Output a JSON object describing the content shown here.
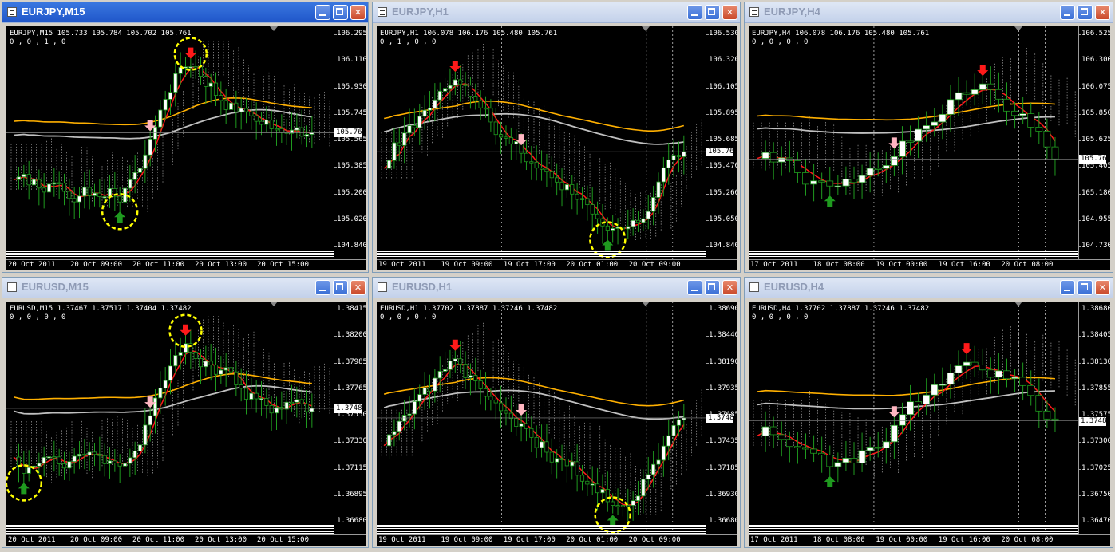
{
  "windows": [
    {
      "id": "eurjpy-m15",
      "title": "EURJPY,M15",
      "active": true,
      "info_line": "EURJPY,M15  105.733 105.784 105.702 105.761",
      "info_line2": "0 , 0 , 1 , 0",
      "current_price": "105.761",
      "price_levels": [
        "106.295",
        "106.110",
        "105.930",
        "105.745",
        "105.565",
        "105.385",
        "105.200",
        "105.020",
        "104.840"
      ],
      "time_labels": [
        "20 Oct 2011",
        "20 Oct 09:00",
        "20 Oct 11:00",
        "20 Oct 13:00",
        "20 Oct 15:00"
      ]
    },
    {
      "id": "eurjpy-h1",
      "title": "EURJPY,H1",
      "active": false,
      "info_line": "EURJPY,H1  106.078 106.176 105.480 105.761",
      "info_line2": "0 , 1 , 0 , 0",
      "current_price": "105.761",
      "price_levels": [
        "106.530",
        "106.320",
        "106.105",
        "105.895",
        "105.685",
        "105.470",
        "105.260",
        "105.050",
        "104.840"
      ],
      "time_labels": [
        "19 Oct 2011",
        "19 Oct 09:00",
        "19 Oct 17:00",
        "20 Oct 01:00",
        "20 Oct 09:00"
      ]
    },
    {
      "id": "eurjpy-h4",
      "title": "EURJPY,H4",
      "active": false,
      "info_line": "EURJPY,H4  106.078 106.176 105.480 105.761",
      "info_line2": "0 , 0 , 0 , 0",
      "current_price": "105.761",
      "price_levels": [
        "106.525",
        "106.300",
        "106.075",
        "105.850",
        "105.625",
        "105.405",
        "105.180",
        "104.955",
        "104.730"
      ],
      "time_labels": [
        "17 Oct 2011",
        "18 Oct 08:00",
        "19 Oct 00:00",
        "19 Oct 16:00",
        "20 Oct 08:00"
      ]
    },
    {
      "id": "eurusd-m15",
      "title": "EURUSD,M15",
      "active": false,
      "info_line": "EURUSD,M15  1.37467 1.37517 1.37404 1.37482",
      "info_line2": "0 , 0 , 0 , 0",
      "current_price": "1.37482",
      "price_levels": [
        "1.38415",
        "1.38200",
        "1.37985",
        "1.37765",
        "1.37550",
        "1.37330",
        "1.37115",
        "1.36895",
        "1.36680"
      ],
      "time_labels": [
        "20 Oct 2011",
        "20 Oct 09:00",
        "20 Oct 11:00",
        "20 Oct 13:00",
        "20 Oct 15:00"
      ]
    },
    {
      "id": "eurusd-h1",
      "title": "EURUSD,H1",
      "active": false,
      "info_line": "EURUSD,H1  1.37702 1.37887 1.37246 1.37482",
      "info_line2": "0 , 0 , 0 , 0",
      "current_price": "1.37482",
      "price_levels": [
        "1.38690",
        "1.38440",
        "1.38190",
        "1.37935",
        "1.37685",
        "1.37435",
        "1.37185",
        "1.36930",
        "1.36680"
      ],
      "time_labels": [
        "19 Oct 2011",
        "19 Oct 09:00",
        "19 Oct 17:00",
        "20 Oct 01:00",
        "20 Oct 09:00"
      ]
    },
    {
      "id": "eurusd-h4",
      "title": "EURUSD,H4",
      "active": false,
      "info_line": "EURUSD,H4  1.37702 1.37887 1.37246 1.37482",
      "info_line2": "0 , 0 , 0 , 0",
      "current_price": "1.37482",
      "price_levels": [
        "1.38680",
        "1.38405",
        "1.38130",
        "1.37855",
        "1.37575",
        "1.37300",
        "1.37025",
        "1.36750",
        "1.36470"
      ],
      "time_labels": [
        "17 Oct 2011",
        "18 Oct 08:00",
        "19 Oct 00:00",
        "19 Oct 16:00",
        "20 Oct 08:00"
      ]
    }
  ],
  "colors": {
    "chart_bg": "#000000",
    "bull_candle": "#ffffff",
    "bear_candle": "#000000",
    "wick": "#1f9a1f",
    "ema_fast": "#ff1a1a",
    "ma_slow": "#ffb000",
    "ma_gray": "#c0c0c0",
    "cloud": "#ffffff",
    "buy_arrow": "#1f9a1f",
    "sell_arrow": "#ff1a1a",
    "sell_arrow_light": "#ffb6c1",
    "highlight_circle": "#ffff00",
    "title_active": "#1f56c9"
  },
  "icons": {
    "window_icon": "chart-window-icon",
    "minimize": "minimize-icon",
    "maximize": "maximize-icon",
    "close": "close-icon"
  }
}
